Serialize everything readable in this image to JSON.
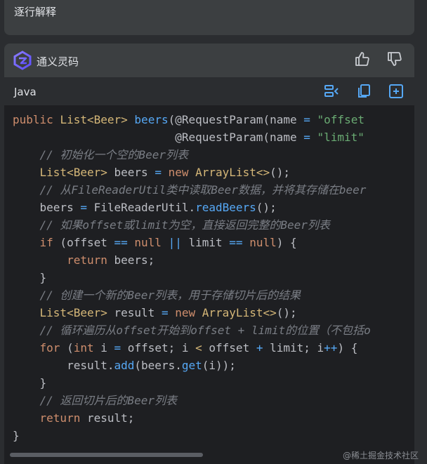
{
  "previous_message": {
    "text": "逐行解释"
  },
  "assistant": {
    "name": "通义灵码"
  },
  "code_block": {
    "language": "Java",
    "lines": [
      "public List<Beer> beers(@RequestParam(name = \"offset",
      "                        @RequestParam(name = \"limit\"",
      "    // 初始化一个空的Beer列表",
      "    List<Beer> beers = new ArrayList<>();",
      "    // 从FileReaderUtil类中读取Beer数据，并将其存储在beer",
      "    beers = FileReaderUtil.readBeers();",
      "    // 如果offset或limit为空，直接返回完整的Beer列表",
      "    if (offset == null || limit == null) {",
      "        return beers;",
      "    }",
      "    // 创建一个新的Beer列表，用于存储切片后的结果",
      "    List<Beer> result = new ArrayList<>();",
      "    // 循环遍历从offset开始到offset + limit的位置（不包括o",
      "    for (int i = offset; i < offset + limit; i++) {",
      "        result.add(beers.get(i));",
      "    }",
      "    // 返回切片后的Beer列表",
      "    return result;",
      "}"
    ]
  },
  "watermark": "@稀土掘金技术社区",
  "colors": {
    "keyword": "#cf8e6d",
    "type": "#d5b778",
    "method": "#56a8f5",
    "string": "#6aab73",
    "comment": "#7a7e85",
    "toolbar_icon": "#56a8f5"
  }
}
